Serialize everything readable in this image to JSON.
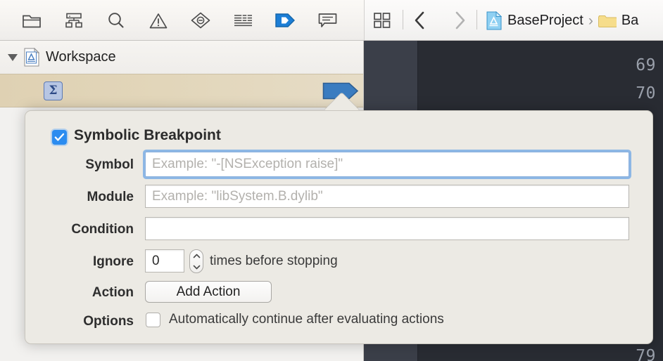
{
  "toolbar": {
    "left_icons": [
      {
        "name": "folder-icon",
        "label": "Project navigator"
      },
      {
        "name": "hierarchy-icon",
        "label": "Symbol navigator"
      },
      {
        "name": "search-icon",
        "label": "Find navigator"
      },
      {
        "name": "warning-triangle-icon",
        "label": "Issue navigator"
      },
      {
        "name": "test-diamond-icon",
        "label": "Test navigator"
      },
      {
        "name": "debug-list-icon",
        "label": "Debug navigator"
      },
      {
        "name": "breakpoint-arrow-icon",
        "label": "Breakpoint navigator"
      },
      {
        "name": "report-bubble-icon",
        "label": "Report navigator"
      }
    ],
    "right_icons": [
      {
        "name": "grid-related-items-icon",
        "label": "Related items"
      }
    ],
    "nav_back_label": "Back",
    "nav_forward_label": "Forward",
    "breadcrumb": [
      {
        "icon": "xcode-project-icon",
        "label": "BaseProject"
      },
      {
        "icon": "folder-yellow-icon",
        "label": "Ba"
      }
    ],
    "breadcrumb_separator": "›"
  },
  "navigator": {
    "workspace": {
      "disclosure_state": "expanded",
      "icon": "workspace-document-icon",
      "label": "Workspace"
    },
    "breakpoint_row": {
      "icon_glyph": "Σ",
      "icon_name": "symbolic-breakpoint-sigma-icon",
      "marker_name": "breakpoint-marker-icon",
      "enabled": true
    }
  },
  "editor": {
    "line_numbers": [
      "69",
      "70",
      "79"
    ]
  },
  "popover": {
    "header": {
      "title": "Symbolic Breakpoint",
      "enabled": true,
      "checkbox_glyph": "✓"
    },
    "fields": {
      "symbol": {
        "label": "Symbol",
        "value": "",
        "placeholder": "Example: \"-[NSException raise]\"",
        "focused": true
      },
      "module": {
        "label": "Module",
        "value": "",
        "placeholder": "Example: \"libSystem.B.dylib\"",
        "focused": false
      },
      "condition": {
        "label": "Condition",
        "value": "",
        "placeholder": "",
        "focused": false
      },
      "ignore": {
        "label": "Ignore",
        "value": "0",
        "placeholder": "",
        "suffix_text": "times before stopping"
      },
      "action": {
        "label": "Action",
        "button_label": "Add Action"
      },
      "options": {
        "label": "Options",
        "checkbox_checked": false,
        "checkbox_text": "Automatically continue after evaluating actions"
      }
    }
  },
  "colors": {
    "accent_blue": "#2b8cf0",
    "focus_ring": "#6ea5e6",
    "breakpoint_blue": "#3a7cc0",
    "selected_row_tan": "#e2d6ba",
    "popover_bg": "#eceae4",
    "editor_bg": "#292c33",
    "gutter_bg": "#3b3f49"
  }
}
